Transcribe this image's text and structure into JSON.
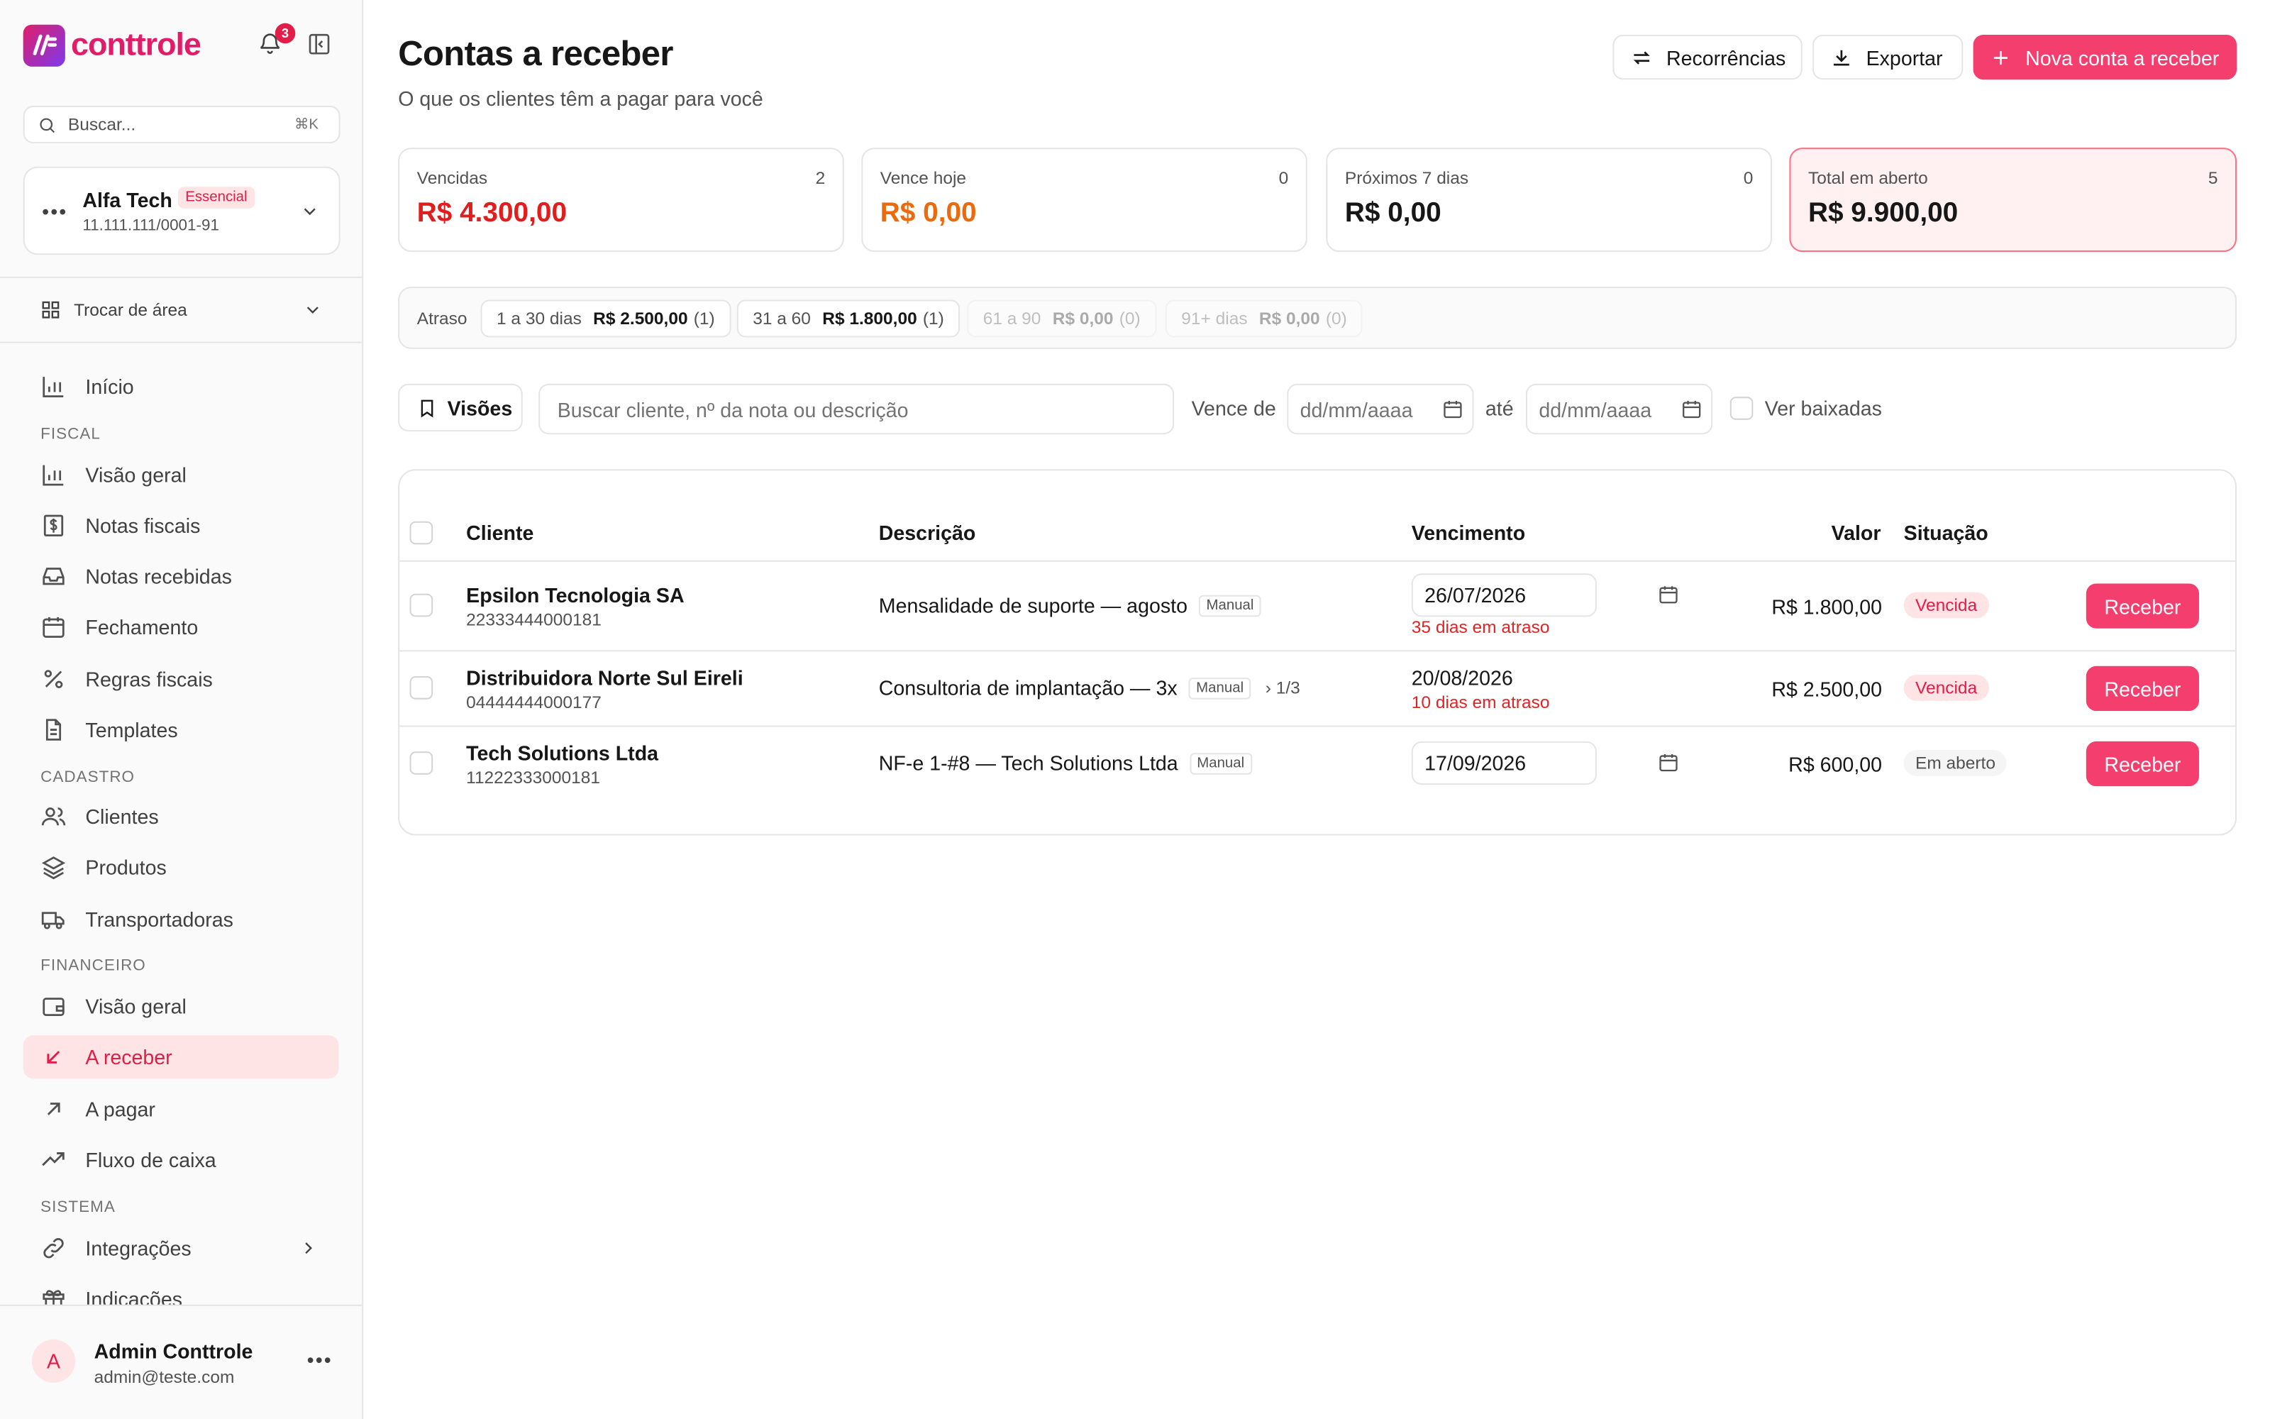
{
  "brand": {
    "name": "conttrole",
    "notification_count": "3"
  },
  "sidebar": {
    "search_placeholder": "Buscar...",
    "search_shortcut": "⌘K",
    "company": {
      "name": "Alfa Tech",
      "plan": "Essencial",
      "cnpj": "11.111.111/0001-91"
    },
    "area_switch": "Trocar de área",
    "nav": {
      "inicio": "Início",
      "fiscal_section": "FISCAL",
      "fiscal_visao": "Visão geral",
      "notas_fiscais": "Notas fiscais",
      "notas_recebidas": "Notas recebidas",
      "fechamento": "Fechamento",
      "regras_fiscais": "Regras fiscais",
      "templates": "Templates",
      "cadastro_section": "CADASTRO",
      "clientes": "Clientes",
      "produtos": "Produtos",
      "transportadoras": "Transportadoras",
      "financeiro_section": "FINANCEIRO",
      "fin_visao": "Visão geral",
      "a_receber": "A receber",
      "a_pagar": "A pagar",
      "fluxo_caixa": "Fluxo de caixa",
      "sistema_section": "SISTEMA",
      "integracoes": "Integrações",
      "indicacoes": "Indicações"
    },
    "user": {
      "initial": "A",
      "name": "Admin Conttrole",
      "email": "admin@teste.com"
    }
  },
  "header": {
    "title": "Contas a receber",
    "subtitle": "O que os clientes têm a pagar para você",
    "btn_recorrencias": "Recorrências",
    "btn_exportar": "Exportar",
    "btn_nova": "Nova conta a receber"
  },
  "summary": [
    {
      "label": "Vencidas",
      "count": "2",
      "value": "R$ 4.300,00",
      "color": "#e11d1d"
    },
    {
      "label": "Vence hoje",
      "count": "0",
      "value": "R$ 0,00",
      "color": "#ea6a0c"
    },
    {
      "label": "Próximos 7 dias",
      "count": "0",
      "value": "R$ 0,00",
      "color": "#171717"
    },
    {
      "label": "Total em aberto",
      "count": "5",
      "value": "R$ 9.900,00",
      "color": "#171717"
    }
  ],
  "aging": {
    "label": "Atraso",
    "buckets": [
      {
        "range": "1 a 30 dias",
        "amount": "R$ 2.500,00",
        "count": "(1)"
      },
      {
        "range": "31 a 60",
        "amount": "R$ 1.800,00",
        "count": "(1)"
      },
      {
        "range": "61 a 90",
        "amount": "R$ 0,00",
        "count": "(0)"
      },
      {
        "range": "91+ dias",
        "amount": "R$ 0,00",
        "count": "(0)"
      }
    ]
  },
  "filters": {
    "visoes": "Visões",
    "search_placeholder": "Buscar cliente, nº da nota ou descrição",
    "vence_de": "Vence de",
    "ate": "até",
    "date_placeholder": "dd/mm/aaaa",
    "ver_baixadas": "Ver baixadas"
  },
  "table": {
    "headers": {
      "cliente": "Cliente",
      "descricao": "Descrição",
      "vencimento": "Vencimento",
      "valor": "Valor",
      "situacao": "Situação"
    },
    "action_label": "Receber",
    "rows": [
      {
        "client": "Epsilon Tecnologia SA",
        "doc": "22333444000181",
        "description": "Mensalidade de suporte — agosto",
        "tag": "Manual",
        "installment": "",
        "due": "26/07/2026",
        "late": "35 dias em atraso",
        "value": "R$ 1.800,00",
        "status": "Vencida"
      },
      {
        "client": "Distribuidora Norte Sul Eireli",
        "doc": "04444444000177",
        "description": "Consultoria de implantação — 3x",
        "tag": "Manual",
        "installment": "› 1/3",
        "due": "20/08/2026",
        "late": "10 dias em atraso",
        "value": "R$ 2.500,00",
        "status": "Vencida"
      },
      {
        "client": "Tech Solutions Ltda",
        "doc": "11222333000181",
        "description": "NF-e 1-#8 — Tech Solutions Ltda",
        "tag": "Manual",
        "installment": "",
        "due": "17/09/2026",
        "late": "",
        "value": "R$ 600,00",
        "status": "Em aberto"
      }
    ]
  }
}
